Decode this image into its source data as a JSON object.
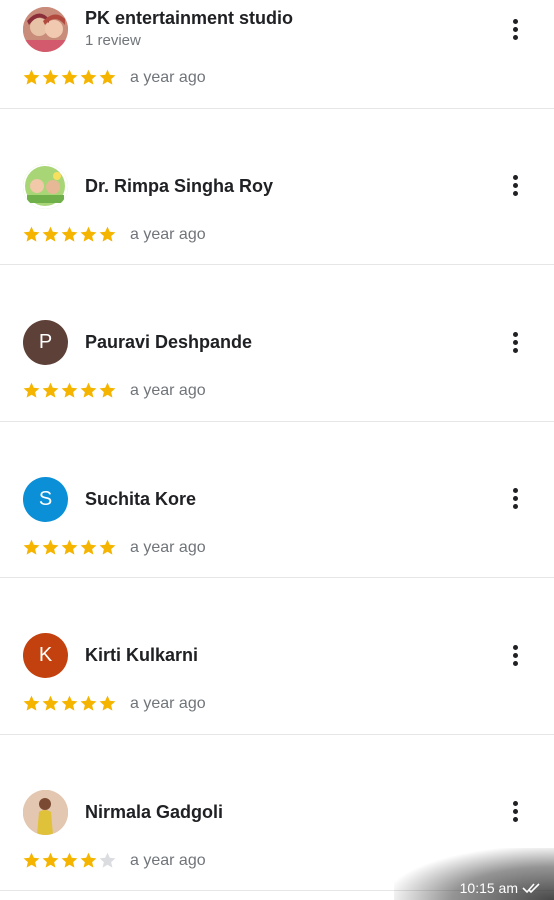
{
  "reviews": [
    {
      "name": "PK entertainment studio",
      "meta": "1 review",
      "rating": 5,
      "date": "a year ago",
      "avatar": {
        "type": "photo",
        "letter": "",
        "color": "#c98b7a"
      }
    },
    {
      "name": "Dr. Rimpa Singha Roy",
      "meta": "",
      "rating": 5,
      "date": "a year ago",
      "avatar": {
        "type": "photo",
        "letter": "",
        "color": "#9ccf6f"
      }
    },
    {
      "name": "Pauravi Deshpande",
      "meta": "",
      "rating": 5,
      "date": "a year ago",
      "avatar": {
        "type": "letter",
        "letter": "P",
        "color": "#5d4037"
      }
    },
    {
      "name": "Suchita Kore",
      "meta": "",
      "rating": 5,
      "date": "a year ago",
      "avatar": {
        "type": "letter",
        "letter": "S",
        "color": "#0b8fd6"
      }
    },
    {
      "name": "Kirti Kulkarni",
      "meta": "",
      "rating": 5,
      "date": "a year ago",
      "avatar": {
        "type": "letter",
        "letter": "K",
        "color": "#c3410e"
      }
    },
    {
      "name": "Nirmala Gadgoli",
      "meta": "",
      "rating": 4,
      "date": "a year ago",
      "avatar": {
        "type": "photo",
        "letter": "",
        "color": "#d9b99a"
      }
    }
  ],
  "colors": {
    "star_filled": "#f4b400",
    "star_empty": "#dadce0"
  },
  "status": {
    "time": "10:15 am",
    "icon": "double-check-icon"
  }
}
